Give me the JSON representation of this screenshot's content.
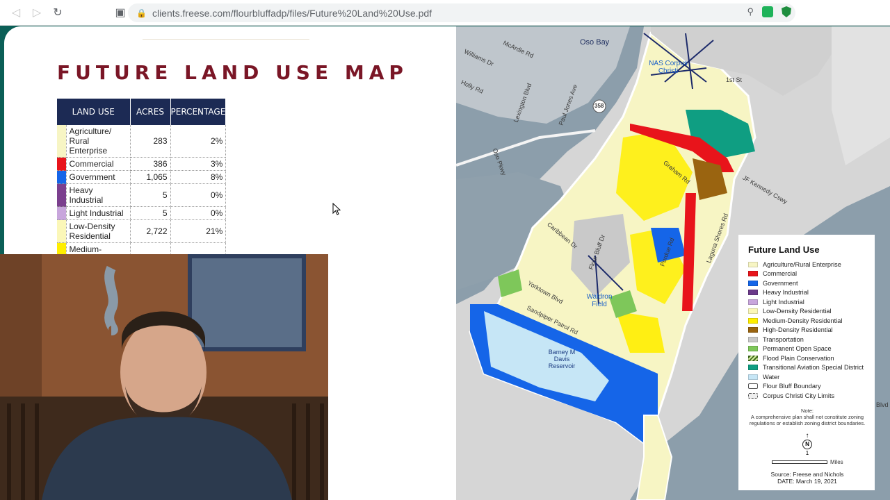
{
  "browser": {
    "url": "clients.freese.com/flourbluffadp/files/Future%20Land%20Use.pdf",
    "back_icon": "back-arrow-icon",
    "forward_icon": "forward-arrow-icon",
    "reload_icon": "reload-icon",
    "bookmark_icon": "bookmark-icon"
  },
  "slide": {
    "title": "FUTURE LAND USE MAP",
    "table": {
      "headers": [
        "LAND USE",
        "ACRES",
        "PERCENTAGE"
      ],
      "rows": [
        {
          "name": "Agriculture/ Rural Enterprise",
          "acres": "283",
          "pct": "2%",
          "color": "#f7f5c4"
        },
        {
          "name": "Commercial",
          "acres": "386",
          "pct": "3%",
          "color": "#e8141b"
        },
        {
          "name": "Government",
          "acres": "1,065",
          "pct": "8%",
          "color": "#1565e8"
        },
        {
          "name": "Heavy Industrial",
          "acres": "5",
          "pct": "0%",
          "color": "#7b3f8e"
        },
        {
          "name": "Light Industrial",
          "acres": "5",
          "pct": "0%",
          "color": "#c8a6dc"
        },
        {
          "name": "Low-Density Residential",
          "acres": "2,722",
          "pct": "21%",
          "color": "#fbf7b8"
        },
        {
          "name": "Medium-",
          "acres": "",
          "pct": "",
          "color": "#ffee00"
        }
      ]
    }
  },
  "map": {
    "labels": {
      "oso_bay": "Oso Bay",
      "nas": "NAS Corpus Christi",
      "williams": "Williams Dr",
      "holly": "Holly Rd",
      "mcardle": "McArdle Rd",
      "lexington": "Lexington Blvd",
      "paul_jones": "Paul Jones Ave",
      "oso_pkwy": "Oso Pkwy",
      "hwy358": "358",
      "graham": "Graham Rd",
      "kennedy": "JF Kennedy Cswy",
      "yorktown": "Yorktown Blvd",
      "sandpiper": "Sandpiper Patrol Rd",
      "waldron": "Waldron Field",
      "barney": "Barney M Davis Reservoir",
      "flour_bluff": "Flour Bluff Dr",
      "caribbean": "Caribbean Dr",
      "purdue": "Purdue Rd",
      "laguna": "Laguna Shores Rd",
      "first_st": "1st St",
      "blvd": "Blvd"
    },
    "legend": {
      "title": "Future Land Use",
      "items": [
        {
          "label": "Agriculture/Rural Enterprise",
          "color": "#f7f5c4"
        },
        {
          "label": "Commercial",
          "color": "#e8141b"
        },
        {
          "label": "Government",
          "color": "#1565e8"
        },
        {
          "label": "Heavy Industrial",
          "color": "#6b3a8a"
        },
        {
          "label": "Light Industrial",
          "color": "#c8a6dc"
        },
        {
          "label": "Low-Density Residential",
          "color": "#fbf7b8"
        },
        {
          "label": "Medium-Density Residential",
          "color": "#ffee00"
        },
        {
          "label": "High-Density Residential",
          "color": "#9a6410"
        },
        {
          "label": "Transportation",
          "color": "#c9c9c9"
        },
        {
          "label": "Permanent Open Space",
          "color": "#7ec75a"
        },
        {
          "label": "Flood Plain Conservation",
          "color": "hatch"
        },
        {
          "label": "Transitional Aviation Special District",
          "color": "#0f9e82"
        },
        {
          "label": "Water",
          "color": "#c6e6f6"
        },
        {
          "label": "Flour Bluff Boundary",
          "color": "boundary"
        },
        {
          "label": "Corpus Christi City Limits",
          "color": "city"
        }
      ],
      "note_title": "Note:",
      "note": "A comprehensive plan shall not constitute zoning regulations or establish zoning district boundaries.",
      "north": "N",
      "scale_value": "1",
      "scale_unit": "Miles",
      "source": "Source: Freese and Nichols",
      "date": "DATE: March 19, 2021"
    }
  }
}
